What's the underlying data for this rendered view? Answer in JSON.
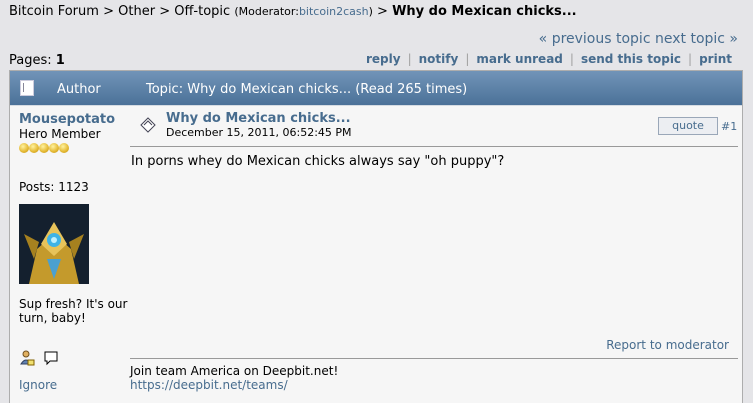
{
  "breadcrumb": {
    "forum": "Bitcoin Forum",
    "sep": ">",
    "board": "Other",
    "subboard": "Off-topic",
    "moderator_label": "(Moderator:",
    "moderator": "bitcoin2cash",
    "moderator_close": ")",
    "topic": "Why do Mexican chicks..."
  },
  "nav": {
    "previous": "« previous topic",
    "next": "next topic »"
  },
  "pages": {
    "label": "Pages:",
    "current": "1"
  },
  "buttons": [
    "reply",
    "notify",
    "mark unread",
    "send this topic",
    "print"
  ],
  "header": {
    "author": "Author",
    "topic": "Topic: Why do Mexican chicks...  (Read 265 times)"
  },
  "poster": {
    "name": "Mousepotato",
    "rank": "Hero Member",
    "stars": 5,
    "posts": "Posts: 1123",
    "personal_text": "Sup fresh? It's our turn, baby!",
    "ignore": "Ignore"
  },
  "post": {
    "subject": "Why do Mexican chicks...",
    "date": "December 15, 2011, 06:52:45 PM",
    "quote": "quote",
    "number": "#1",
    "body": "In porns whey do Mexican chicks always say \"oh puppy\"?",
    "report": "Report to moderator",
    "signature_line": "Join team America on Deepbit.net!",
    "signature_link": "https://deepbit.net/teams/"
  },
  "colors": {
    "link": "#476c8e",
    "header_bg": "#5a80a6",
    "page_bg": "#e5e5e8"
  }
}
